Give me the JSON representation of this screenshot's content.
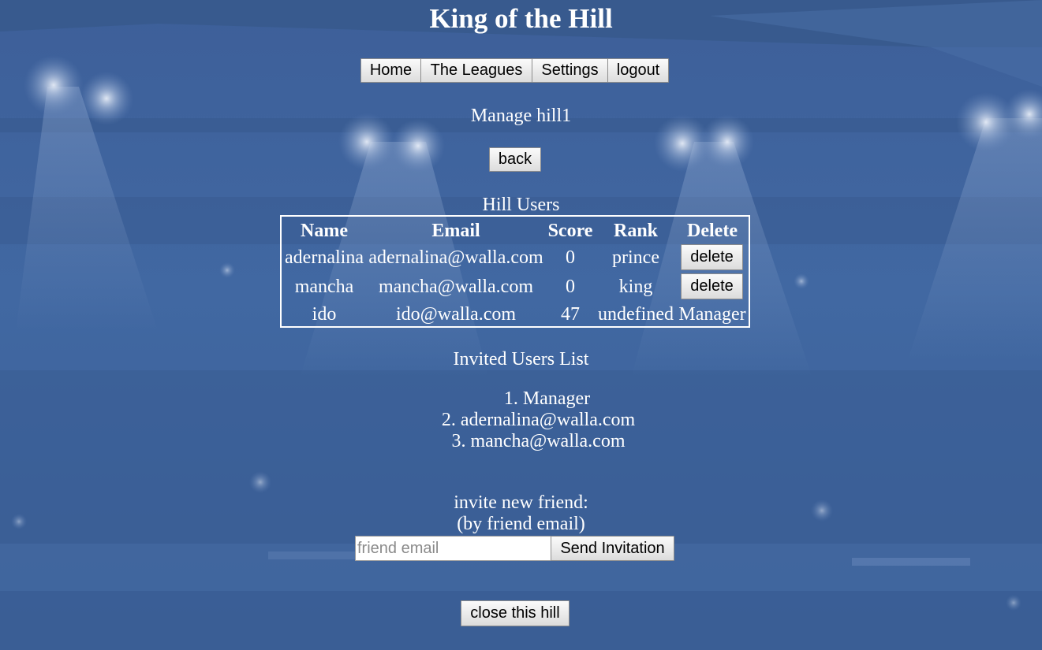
{
  "app": {
    "title": "King of the Hill"
  },
  "nav": {
    "home": "Home",
    "leagues": "The Leagues",
    "settings": "Settings",
    "logout": "logout"
  },
  "page": {
    "subtitle": "Manage hill1",
    "back_label": "back"
  },
  "users_table": {
    "caption": "Hill Users",
    "headers": [
      "Name",
      "Email",
      "Score",
      "Rank",
      "Delete"
    ],
    "rows": [
      {
        "name": "adernalina",
        "email": "adernalina@walla.com",
        "score": "0",
        "rank": "prince",
        "delete": "delete"
      },
      {
        "name": "mancha",
        "email": "mancha@walla.com",
        "score": "0",
        "rank": "king",
        "delete": "delete"
      },
      {
        "name": "ido",
        "email": "ido@walla.com",
        "score": "47",
        "rank": "undefined",
        "delete": "Manager"
      }
    ]
  },
  "invited": {
    "label": "Invited Users List",
    "items": [
      "1. Manager",
      "2. adernalina@walla.com",
      "3. mancha@walla.com"
    ]
  },
  "invite": {
    "line1": "invite new friend:",
    "line2": "(by friend email)",
    "input_value": "",
    "input_placeholder": "friend email",
    "send_label": "Send Invitation"
  },
  "close_label": "close this hill",
  "colors": {
    "background": "#3f629a",
    "text": "#ffffff"
  }
}
